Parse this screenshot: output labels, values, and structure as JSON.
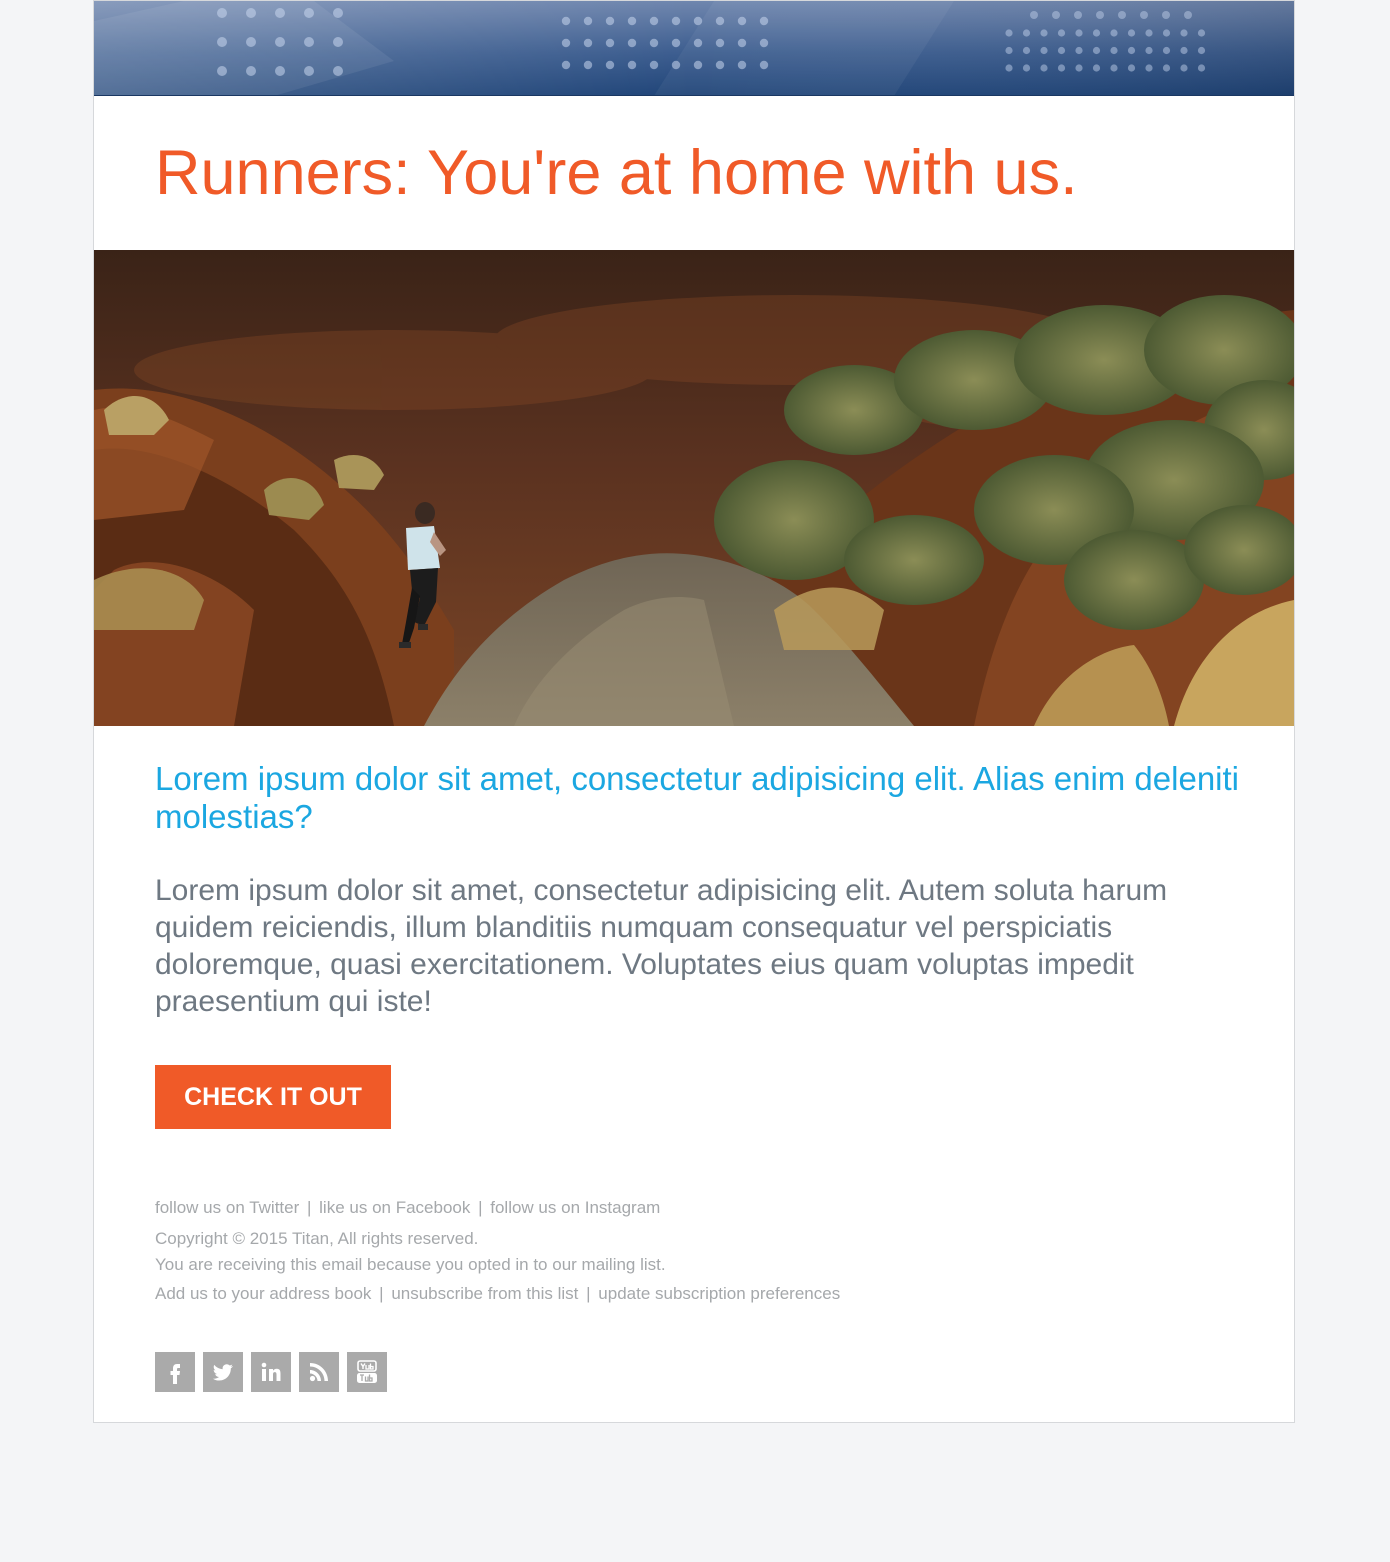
{
  "colors": {
    "page_bg": "#f4f5f7",
    "headline": "#f05a28",
    "subhead": "#1ba7e1",
    "body_text": "#6e7882",
    "cta_bg": "#f05a28",
    "cta_text": "#ffffff",
    "footer_text": "#a5a8ab",
    "social_bg": "#aaaaaa",
    "banner_dark": "#1f4478",
    "banner_light": "#6f86ae"
  },
  "banner": {
    "icon": "abstract-dot-pattern-banner"
  },
  "headline": "Runners: You're at home with us.",
  "hero_image": {
    "icon": "runner-on-trail-photo"
  },
  "subhead": "Lorem ipsum dolor sit amet, consectetur adipisicing elit. Alias enim deleniti molestias?",
  "body_text": "Lorem ipsum dolor sit amet, consectetur adipisicing elit. Autem soluta harum quidem reiciendis, illum blanditiis numquam consequatur vel perspiciatis doloremque, quasi exercitationem. Voluptates eius quam voluptas impedit praesentium qui iste!",
  "cta_label": "CHECK IT OUT",
  "footer": {
    "follow_links": [
      "follow us on Twitter",
      "like us on Facebook",
      "follow us on Instagram"
    ],
    "separator": "|",
    "copyright": "Copyright © 2015 Titan, All rights reserved.",
    "receiving_notice": "You are receiving this email because you opted in to our mailing list.",
    "action_links": [
      "Add us to your address book",
      "unsubscribe from this list",
      "update subscription preferences"
    ]
  },
  "social_icons": [
    "facebook-icon",
    "twitter-icon",
    "linkedin-icon",
    "rss-icon",
    "youtube-icon"
  ]
}
